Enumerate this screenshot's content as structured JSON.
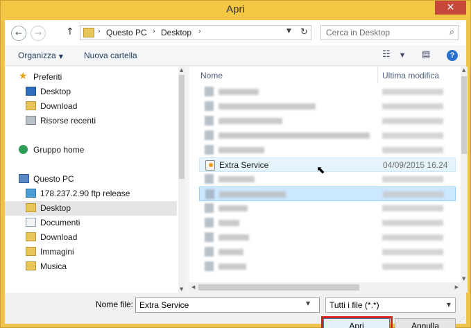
{
  "window": {
    "title": "Apri",
    "close_glyph": "✕"
  },
  "address": {
    "back_glyph": "←",
    "forward_glyph": "→",
    "up_glyph": "↑",
    "crumbs": [
      "Questo PC",
      "Desktop"
    ],
    "separator_glyph": "›",
    "dropdown_glyph": "▼",
    "refresh_glyph": "↻"
  },
  "search": {
    "placeholder": "Cerca in Desktop",
    "icon": "search-icon",
    "icon_glyph": "⌕"
  },
  "toolbar": {
    "organize_label": "Organizza",
    "new_folder_label": "Nuova cartella",
    "dropdown_glyph": "▼",
    "view_glyph": "☷",
    "preview_pane_glyph": "▤",
    "help_glyph": "?"
  },
  "nav": {
    "items": [
      {
        "label": "Preferiti",
        "icon": "star-icon",
        "glyph": "★"
      },
      {
        "label": "Desktop",
        "icon": "desktop-icon"
      },
      {
        "label": "Download",
        "icon": "folder-icon"
      },
      {
        "label": "Risorse recenti",
        "icon": "recent-icon"
      },
      {
        "label": "Gruppo home",
        "icon": "homegroup-icon"
      },
      {
        "label": "Questo PC",
        "icon": "computer-icon"
      },
      {
        "label": "178.237.2.90 ftp release",
        "icon": "network-location-icon"
      },
      {
        "label": "Desktop",
        "icon": "folder-icon",
        "selected": true
      },
      {
        "label": "Documenti",
        "icon": "documents-icon"
      },
      {
        "label": "Download",
        "icon": "folder-icon"
      },
      {
        "label": "Immagini",
        "icon": "pictures-icon"
      },
      {
        "label": "Musica",
        "icon": "music-icon"
      }
    ]
  },
  "files": {
    "column_name": "Nome",
    "column_date": "Ultima modifica",
    "highlighted_row": {
      "name": "Extra Service",
      "date": "04/09/2015 16.24",
      "icon": "shortcut-icon"
    }
  },
  "bottom": {
    "filename_label": "Nome file:",
    "filename_value": "Extra Service",
    "filetype_value": "Tutti i file (*.*)",
    "dropdown_glyph": "▼",
    "open_label": "Apri",
    "cancel_label": "Annulla"
  },
  "colors": {
    "title_bar": "#f3c744",
    "close_button": "#c7473b",
    "selection": "#cce8ff",
    "highlight_outline": "#d2201f"
  }
}
